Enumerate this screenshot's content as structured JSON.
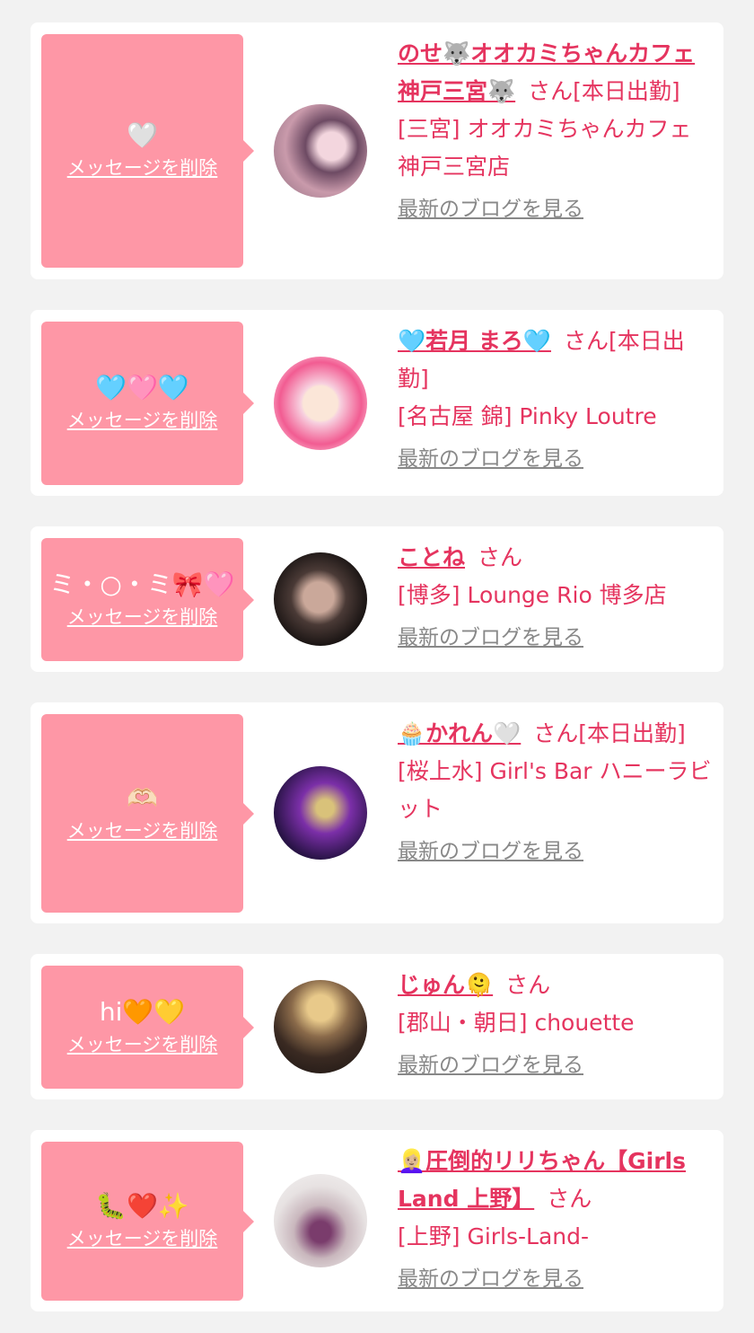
{
  "delete_label": "メッセージを削除",
  "blog_label": "最新のブログを見る",
  "san_suffix": "さん",
  "colors": {
    "accent": "#e5345f",
    "bubble": "#fe97a6",
    "link_gray": "#888888",
    "background": "#f2f2f2"
  },
  "entries": [
    {
      "message": "🤍",
      "name": "のせ🐺オオカミちゃんカフェ神戸三宮🐺",
      "status": "[本日出勤]",
      "shop": "[三宮] オオカミちゃんカフェ神戸三宮店"
    },
    {
      "message": "🩵🩷🩵",
      "name": "🩵若月 まろ🩵",
      "status": "[本日出勤]",
      "shop": "[名古屋 錦] Pinky Loutre"
    },
    {
      "message": "ミ・○・ミ🎀🩷",
      "name": "ことね",
      "status": "",
      "shop": "[博多] Lounge Rio 博多店"
    },
    {
      "message": "🫶🏻",
      "name": "🧁かれん🤍",
      "status": "[本日出勤]",
      "shop": "[桜上水] Girl's Bar ハニーラビット"
    },
    {
      "message": "hi🧡💛",
      "name": "じゅん🫠",
      "status": "",
      "shop": "[郡山・朝日] chouette"
    },
    {
      "message": "🐛❤️✨",
      "name": "👱🏼‍♀️圧倒的リリちゃん【Girls Land 上野】",
      "status": "",
      "shop": "[上野] Girls-Land-"
    }
  ]
}
